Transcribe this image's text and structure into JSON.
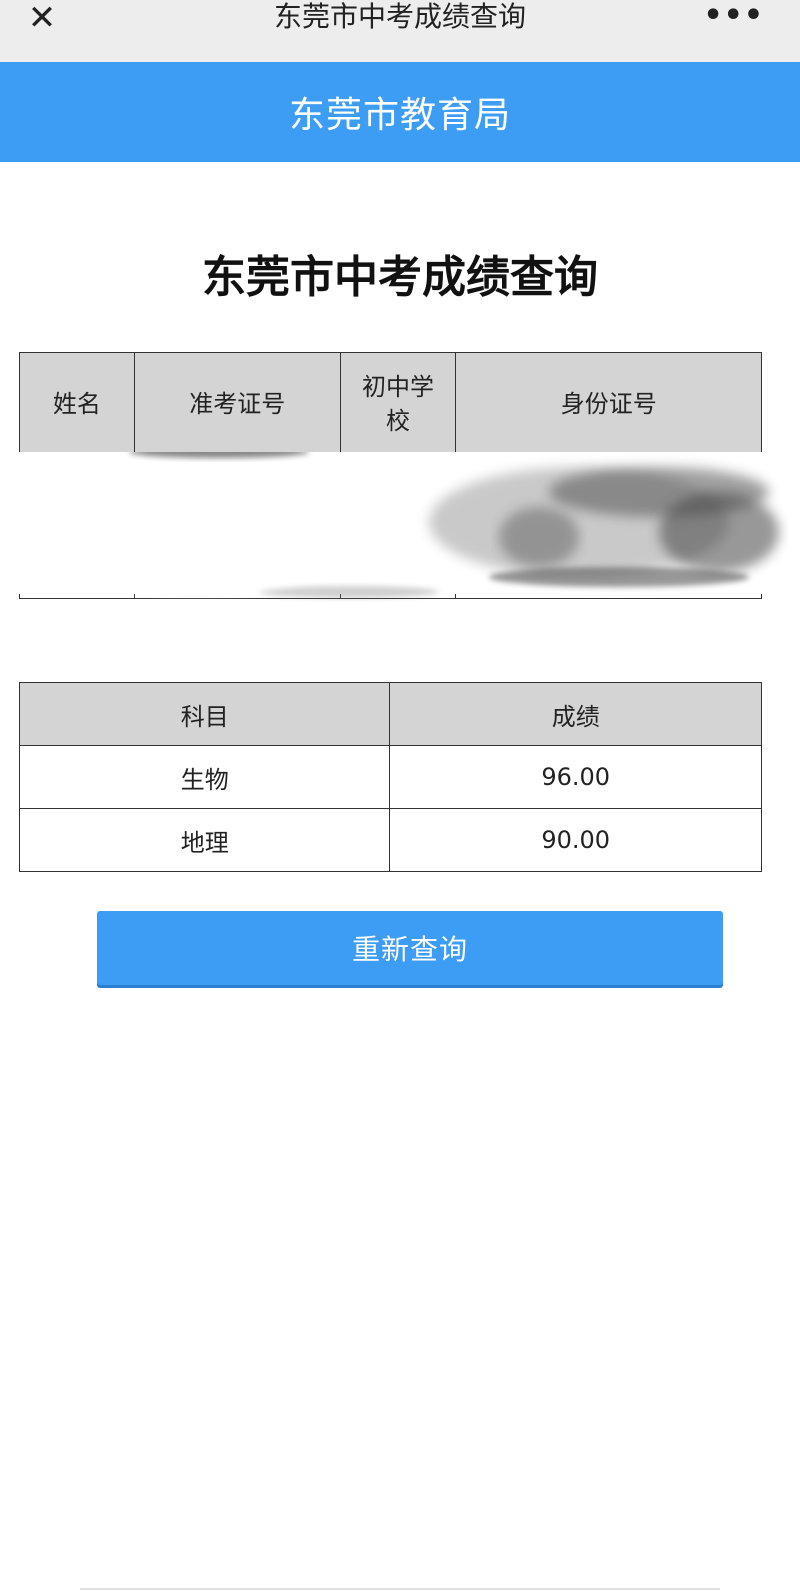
{
  "topbar": {
    "title": "东莞市中考成绩查询",
    "close_icon": "close-icon",
    "more_icon": "more-icon",
    "close_glyph": "✕",
    "more_glyph": "•••"
  },
  "banner": {
    "text": "东莞市教育局"
  },
  "page_title": "东莞市中考成绩查询",
  "info_table": {
    "headers": [
      "姓名",
      "准考证号",
      "初中学校",
      "身份证号"
    ],
    "header_school_line1": "初中学",
    "header_school_line2": "校"
  },
  "score_table": {
    "headers": [
      "科目",
      "成绩"
    ],
    "rows": [
      {
        "subject": "生物",
        "score": "96.00"
      },
      {
        "subject": "地理",
        "score": "90.00"
      }
    ]
  },
  "requery_button": "重新查询",
  "colors": {
    "accent": "#3d9cf3",
    "header_bg": "#d4d4d4",
    "topbar_bg": "#ededed"
  }
}
